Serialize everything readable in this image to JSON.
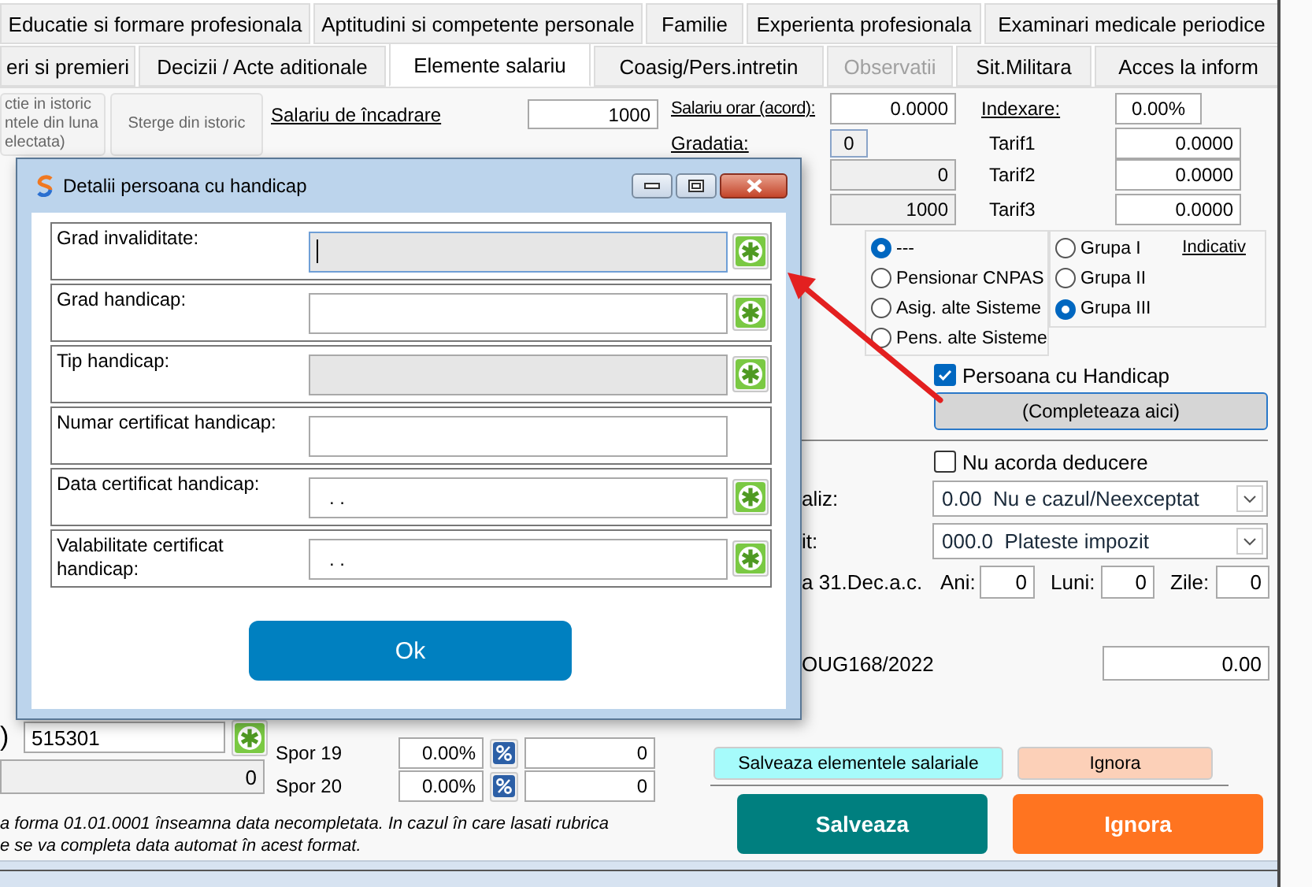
{
  "tabs": {
    "row_1": [
      {
        "label": "Educatie si formare profesionala",
        "selected": false
      },
      {
        "label": "Aptitudini si competente personale",
        "selected": false
      },
      {
        "label": "Familie",
        "selected": false
      },
      {
        "label": "Experienta profesionala",
        "selected": false
      },
      {
        "label": "Examinari medicale periodice",
        "selected": false
      }
    ],
    "row_2": [
      {
        "label": "eri si premieri",
        "selected": false,
        "disabled": false
      },
      {
        "label": "Decizii / Acte aditionale",
        "selected": false,
        "disabled": false
      },
      {
        "label": "Elemente salariu",
        "selected": true,
        "disabled": false
      },
      {
        "label": "Coasig/Pers.intretin",
        "selected": false,
        "disabled": false
      },
      {
        "label": "Observatii",
        "selected": false,
        "disabled": true
      },
      {
        "label": "Sit.Militara",
        "selected": false,
        "disabled": false
      },
      {
        "label": "Acces la inform",
        "selected": false,
        "disabled": false
      }
    ]
  },
  "history_buttons": [
    "ctie in istoric\nntele din luna\nelectata)",
    "Sterge din istoric"
  ],
  "base_salary": {
    "label": "Salariu de încadrare",
    "value": "1000"
  },
  "hourly_salary": {
    "label": "Salariu orar (acord):",
    "value": "0.0000"
  },
  "indexation": {
    "label": "Indexare:",
    "value": "0.00%"
  },
  "gradation": {
    "label": "Gradatia:",
    "value": "0"
  },
  "computed_fields": [
    "0",
    "1000"
  ],
  "tariffs": [
    {
      "label": "Tarif1",
      "value": "0.0000"
    },
    {
      "label": "Tarif2",
      "value": "0.0000"
    },
    {
      "label": "Tarif3",
      "value": "0.0000"
    }
  ],
  "insurance_types": [
    {
      "label": "---",
      "selected": true
    },
    {
      "label": "Pensionar CNPAS",
      "selected": false
    },
    {
      "label": "Asig. alte Sisteme",
      "selected": false
    },
    {
      "label": "Pens. alte Sisteme",
      "selected": false
    }
  ],
  "groups": [
    {
      "label": "Grupa I",
      "selected": false
    },
    {
      "label": "Grupa II",
      "selected": false
    },
    {
      "label": "Grupa III",
      "selected": true
    }
  ],
  "indicativ_link": "Indicativ",
  "handicap": {
    "label": "Persoana cu Handicap",
    "checked": true
  },
  "complete_button": "(Completeaza aici)",
  "no_deduction": {
    "label": "Nu acorda deducere",
    "checked": false
  },
  "dropdowns": [
    {
      "label": "aliz:",
      "value": "0.00  Nu e cazul/Neexceptat"
    },
    {
      "label": "it:",
      "value": "000.0  Plateste impozit"
    }
  ],
  "seniority": {
    "label": "a 31.Dec.a.c.",
    "fields": [
      {
        "label": "Ani:",
        "value": "0"
      },
      {
        "label": "Luni:",
        "value": "0"
      },
      {
        "label": "Zile:",
        "value": "0"
      }
    ]
  },
  "oug": {
    "label": "OUG168/2022",
    "value": "0.00"
  },
  "code_field": {
    "label": ")",
    "value": "515301"
  },
  "total_field": "0",
  "bonuses": [
    {
      "label": "Spor 19",
      "percent": "0.00%",
      "amount": "0"
    },
    {
      "label": "Spor 20",
      "percent": "0.00%",
      "amount": "0"
    }
  ],
  "note": [
    "a forma 01.01.0001 înseamna data necompletata. In cazul în care lasati rubrica",
    "e se va completa data automat în acest format."
  ],
  "small_buttons": [
    {
      "label": "Salveaza elementele salariale",
      "color": "#a6fbfb"
    },
    {
      "label": "Ignora",
      "color": "#fcd0b8"
    }
  ],
  "main_buttons": [
    {
      "label": "Salveaza",
      "color": "#007f7f"
    },
    {
      "label": "Ignora",
      "color": "#ff7420"
    }
  ],
  "dialog": {
    "title": "Detalii persoana cu handicap",
    "fields": [
      {
        "label": "Grad invaliditate:",
        "readonly": true,
        "focused": true,
        "picker": true
      },
      {
        "label": "Grad handicap:",
        "readonly": false,
        "focused": false,
        "picker": true
      },
      {
        "label": "Tip handicap:",
        "readonly": true,
        "focused": false,
        "picker": true
      },
      {
        "label": "Numar certificat handicap:",
        "readonly": false,
        "focused": false,
        "picker": false
      },
      {
        "label": "Data certificat handicap:",
        "value": ". .",
        "readonly": false,
        "focused": false,
        "picker": true
      },
      {
        "label": "Valabilitate certificat handicap:",
        "value": ". .",
        "readonly": false,
        "focused": false,
        "picker": true
      }
    ],
    "ok_button": "Ok"
  }
}
